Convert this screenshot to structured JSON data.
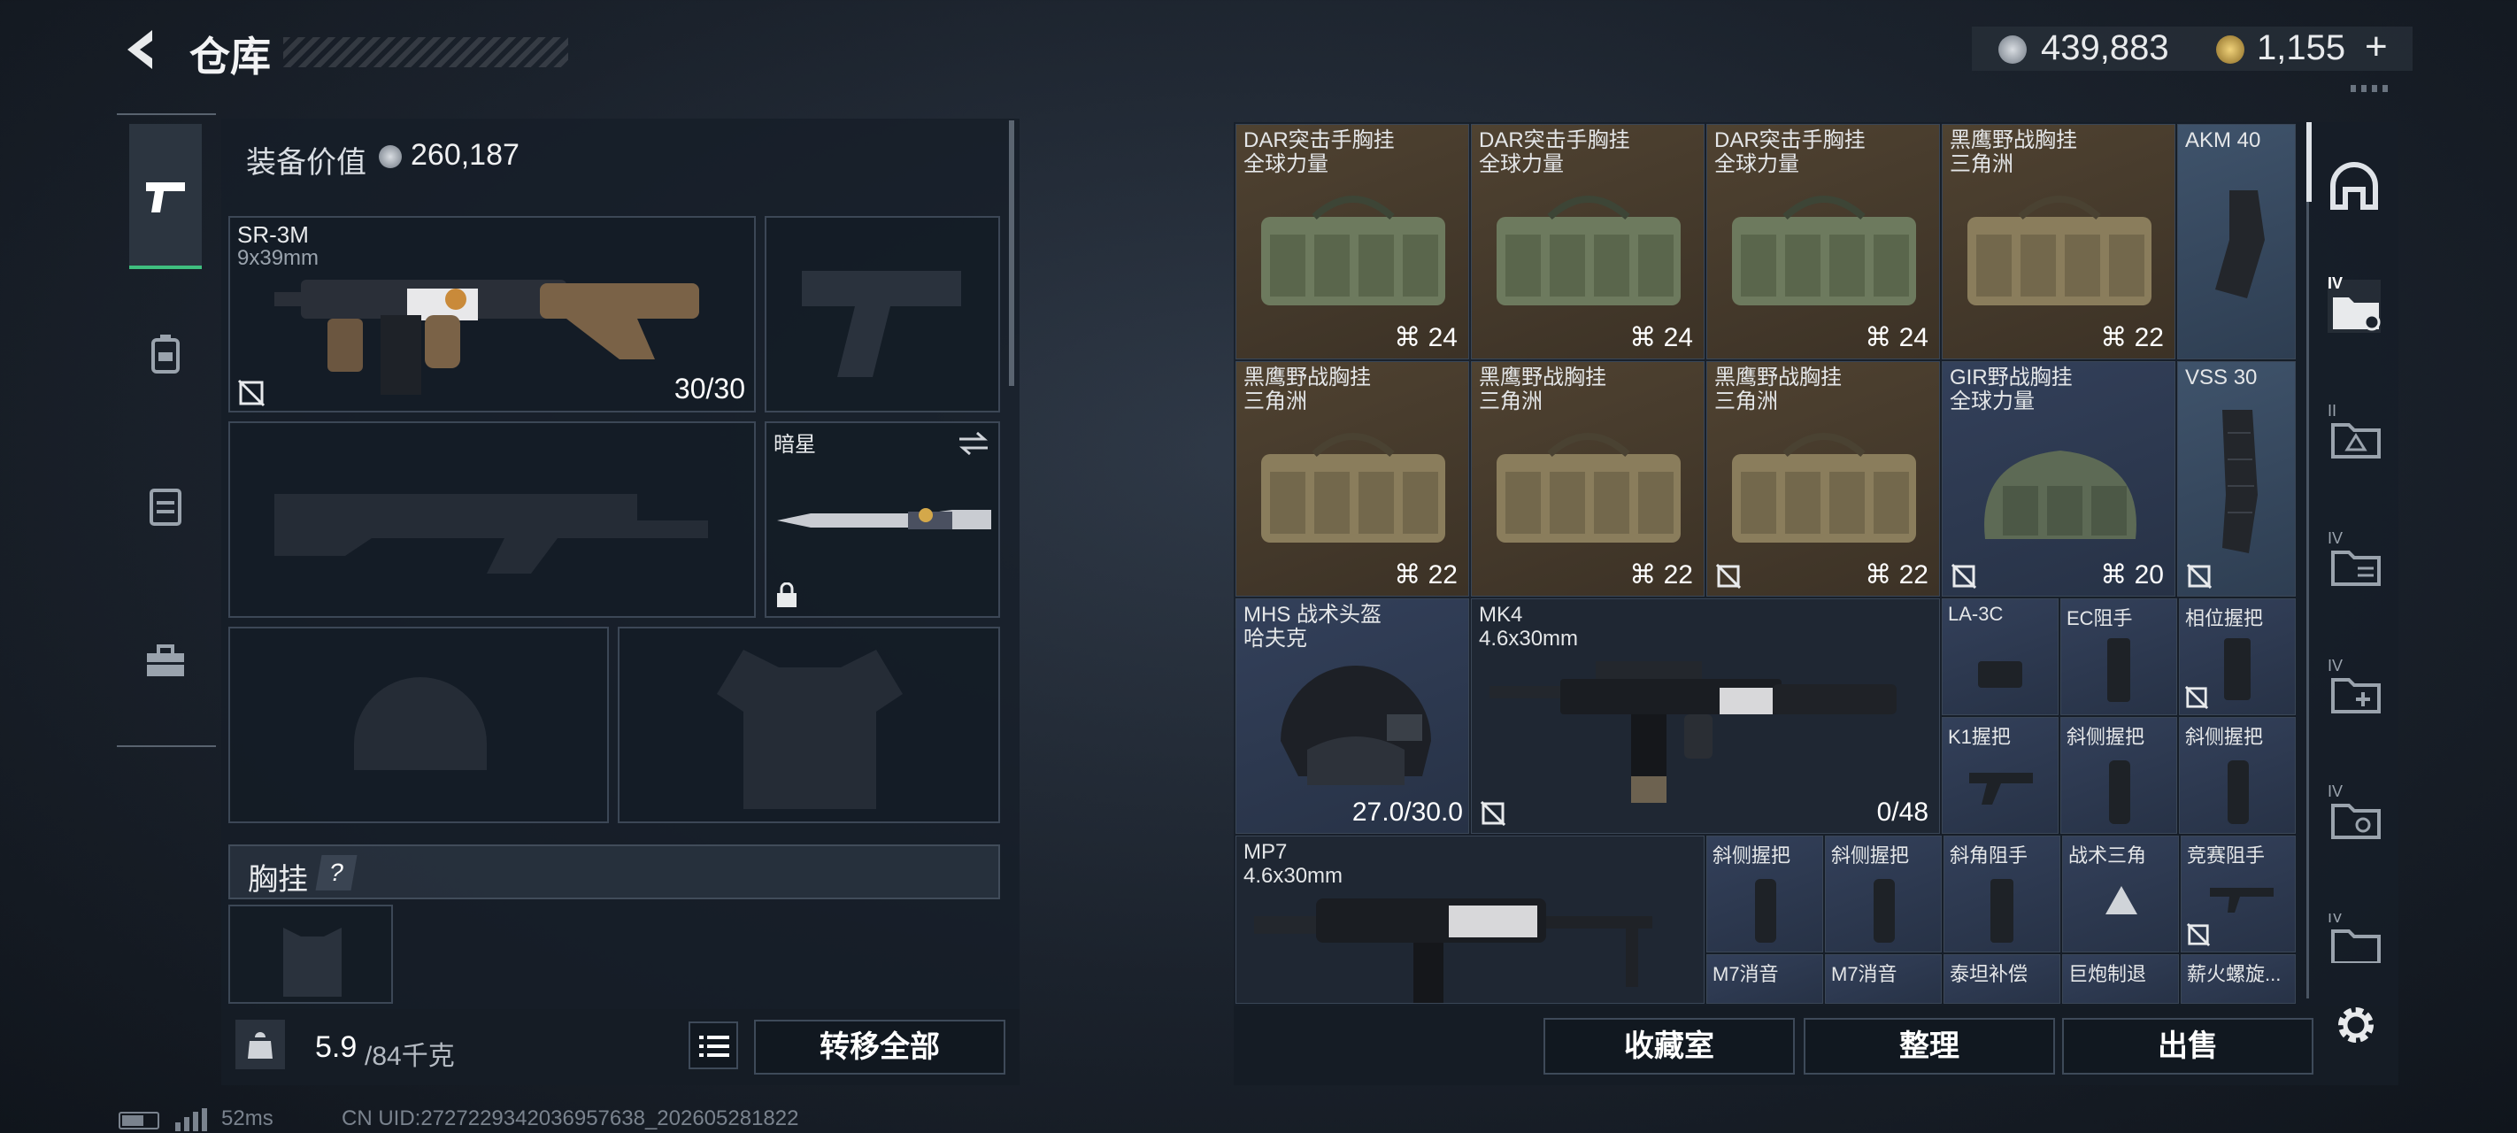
{
  "header": {
    "title": "仓库",
    "currency_silver": "439,883",
    "currency_gold": "1,155",
    "plus": "+"
  },
  "loadout": {
    "value_label": "装备价值",
    "value": "260,187",
    "primary": {
      "name": "SR-3M",
      "caliber": "9x39mm",
      "ammo": "30/30"
    },
    "melee": {
      "name": "暗星"
    },
    "chest_label": "胸挂",
    "chest_help": "?",
    "weight_current": "5.9",
    "weight_max": "/84千克",
    "transfer_all": "转移全部"
  },
  "stash_items": [
    {
      "label": "DAR突击手胸挂\n全球力量",
      "count": "24"
    },
    {
      "label": "DAR突击手胸挂\n全球力量",
      "count": "24"
    },
    {
      "label": "DAR突击手胸挂\n全球力量",
      "count": "24"
    },
    {
      "label": "黑鹰野战胸挂\n三角洲",
      "count": "22"
    },
    {
      "label": "AKM 40"
    },
    {
      "label": "黑鹰野战胸挂\n三角洲",
      "count": "22"
    },
    {
      "label": "黑鹰野战胸挂\n三角洲",
      "count": "22"
    },
    {
      "label": "黑鹰野战胸挂\n三角洲",
      "count": "22"
    },
    {
      "label": "GIR野战胸挂\n全球力量",
      "count": "20"
    },
    {
      "label": "VSS 30"
    },
    {
      "label": "MHS 战术头盔\n哈夫克",
      "count": "27.0/30.0"
    },
    {
      "label": "MK4\n4.6x30mm",
      "count": "0/48"
    },
    {
      "label": "MP7\n4.6x30mm"
    }
  ],
  "small_items": [
    "LA-3C",
    "EC阻手",
    "相位握把",
    "K1握把",
    "斜侧握把",
    "斜侧握把",
    "斜侧握把",
    "斜侧握把",
    "斜角阻手",
    "战术三角",
    "竞赛阻手",
    "M7消音",
    "M7消音",
    "泰坦补偿",
    "巨炮制退",
    "薪火螺旋..."
  ],
  "tier_labels": [
    "IV",
    "II",
    "IV",
    "IV",
    "IV",
    "IV"
  ],
  "actions": {
    "collection": "收藏室",
    "sort": "整理",
    "sell": "出售"
  },
  "status": {
    "ping": "52ms",
    "uid": "CN UID:2727229342036957638_202605281822"
  },
  "colors": {
    "accent_green": "#3fbf7f",
    "slot_brown": "#4a3d2e",
    "slot_navy": "#2f3a51",
    "slot_blue": "#3a4c63"
  }
}
